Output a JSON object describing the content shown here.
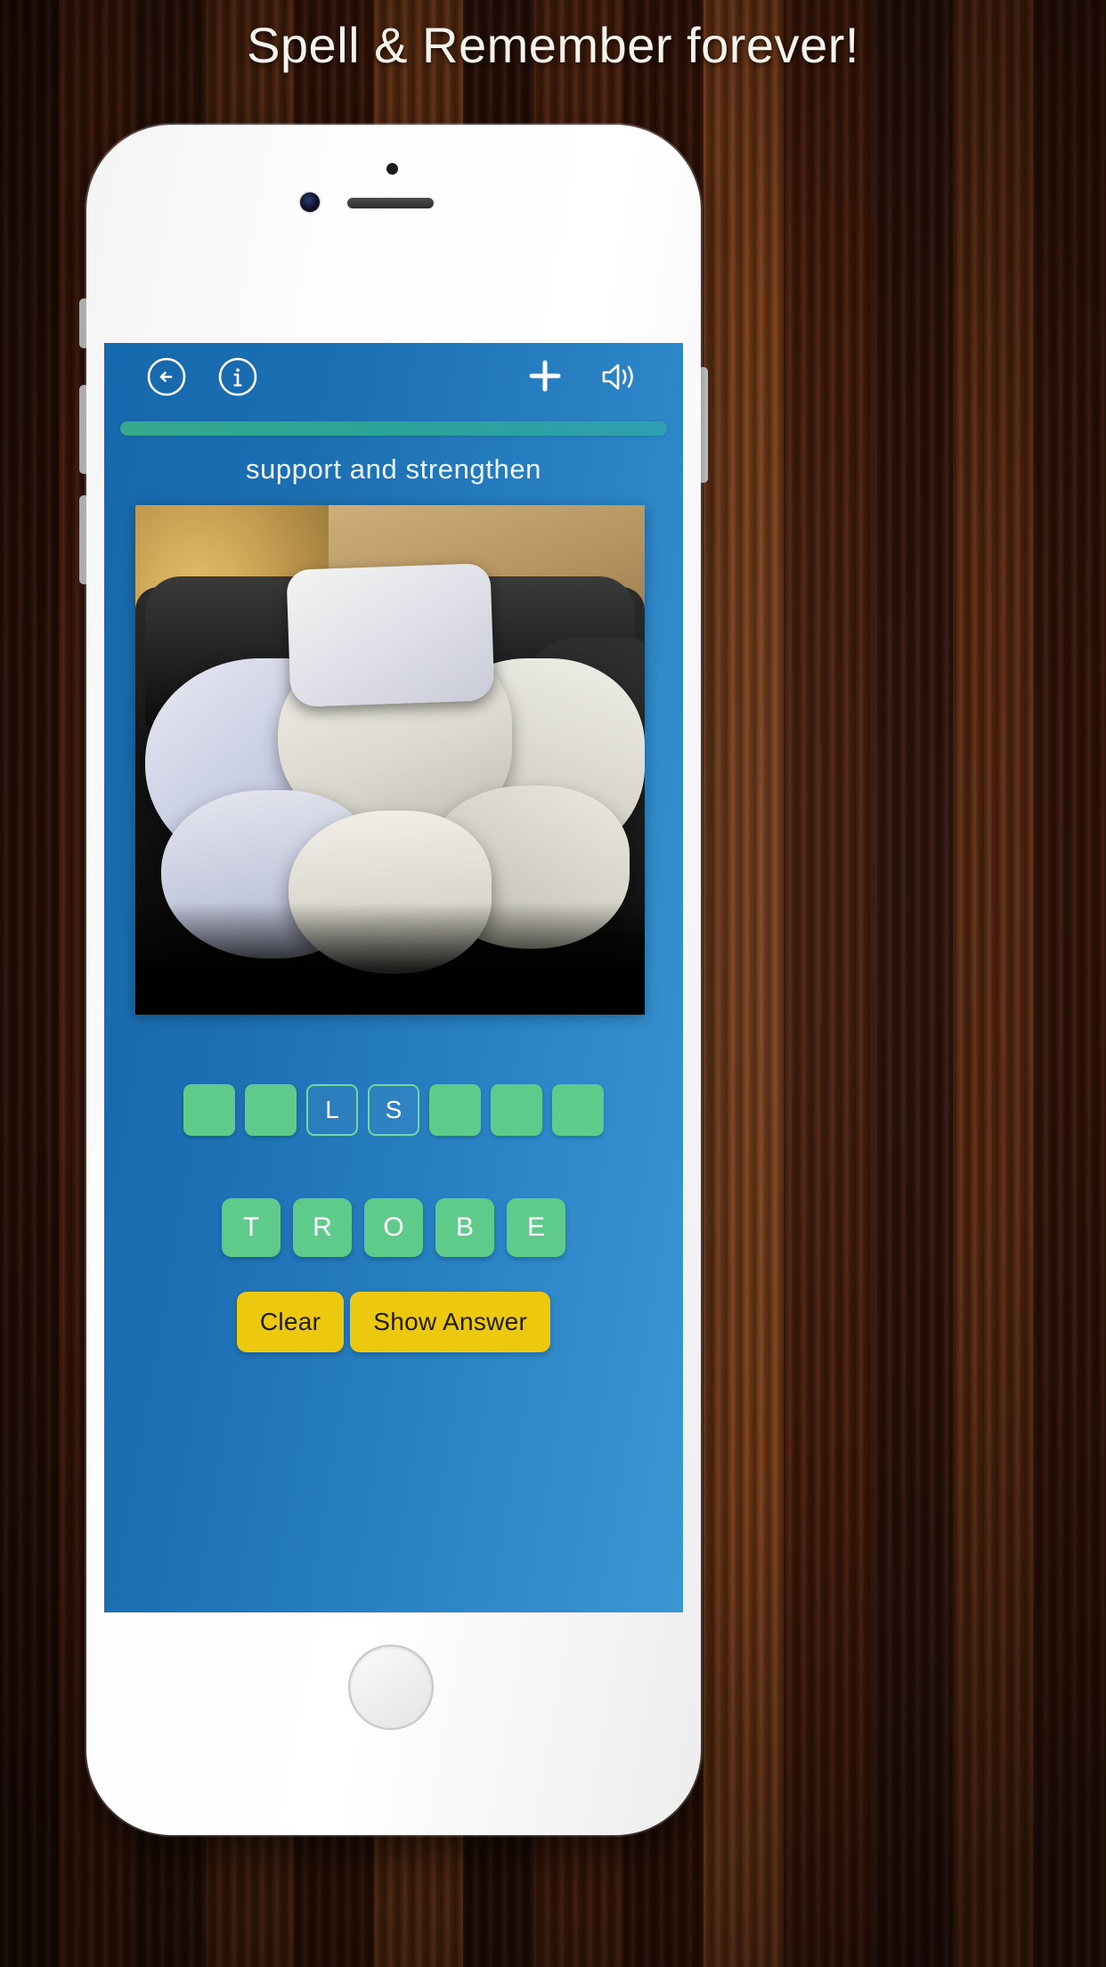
{
  "headline": "Spell & Remember forever!",
  "app": {
    "navbar": {
      "back_icon": "back-arrow-circle-icon",
      "info_icon": "info-circle-icon",
      "add_icon": "plus-icon",
      "sound_icon": "speaker-volume-icon"
    },
    "progress": {
      "percent": 100,
      "fill_color": "#2aa398",
      "track_color": "#2b7cb8"
    },
    "clue": "support and strengthen",
    "image": {
      "alt": "pile of white pillows on a black leather sofa",
      "background_color": "#000000"
    },
    "answer_slots": [
      {
        "letter": "",
        "state": "empty"
      },
      {
        "letter": "",
        "state": "empty"
      },
      {
        "letter": "L",
        "state": "filled"
      },
      {
        "letter": "S",
        "state": "filled"
      },
      {
        "letter": "",
        "state": "empty"
      },
      {
        "letter": "",
        "state": "empty"
      },
      {
        "letter": "",
        "state": "empty"
      }
    ],
    "letter_bank": [
      "T",
      "R",
      "O",
      "B",
      "E"
    ],
    "buttons": {
      "clear": "Clear",
      "show_answer": "Show Answer"
    },
    "colors": {
      "screen_blue_dark": "#1668ad",
      "screen_blue_light": "#3d96d4",
      "tile_green": "#5ecb8a",
      "button_yellow": "#ecc90f"
    }
  }
}
